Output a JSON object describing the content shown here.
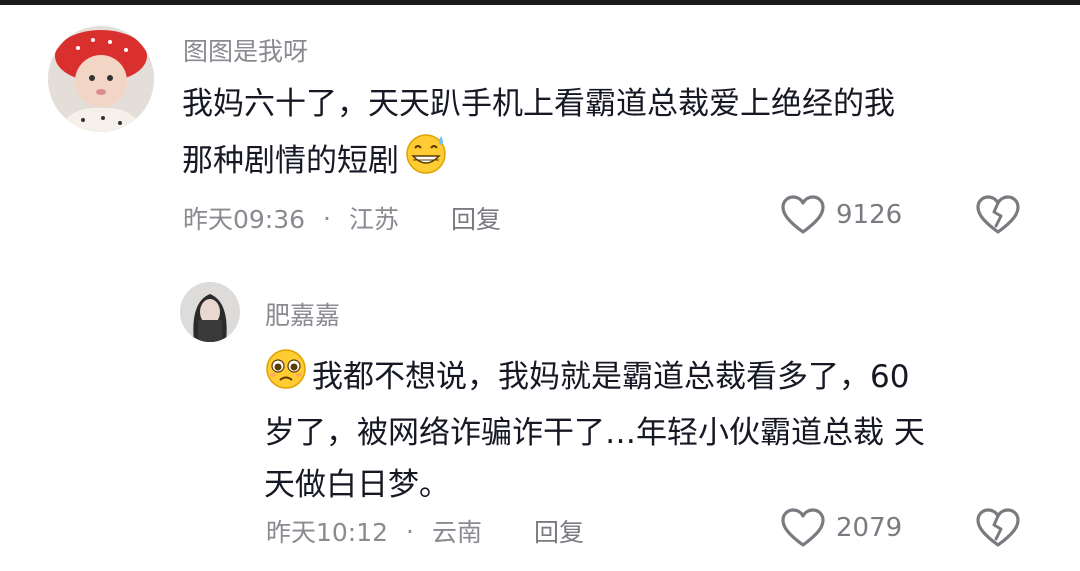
{
  "comments": [
    {
      "username": "图图是我呀",
      "text_line1": "我妈六十了，天天趴手机上看霸道总裁爱上绝经的我",
      "text_line2": "那种剧情的短剧",
      "time": "昨天09:36",
      "location": "江苏",
      "reply_label": "回复",
      "like_count": "9126",
      "emoji_trailing": "grinning-sweat-emoji"
    },
    {
      "username": "肥嘉嘉",
      "text_line1": "我都不想说，我妈就是霸道总裁看多了，60",
      "text_line2": "岁了，被网络诈骗诈干了…年轻小伙霸道总裁 天",
      "text_line3": "天做白日梦。",
      "time": "昨天10:12",
      "location": "云南",
      "reply_label": "回复",
      "like_count": "2079",
      "emoji_leading": "pleading-face-emoji"
    }
  ],
  "separator": "·",
  "icons": {
    "like": "heart-outline-icon",
    "dislike": "broken-heart-icon"
  },
  "colors": {
    "text": "#161823",
    "meta": "#8a8b91",
    "avatar1_hat": "#d9302f",
    "emoji_yellow": "#ffcc33"
  }
}
